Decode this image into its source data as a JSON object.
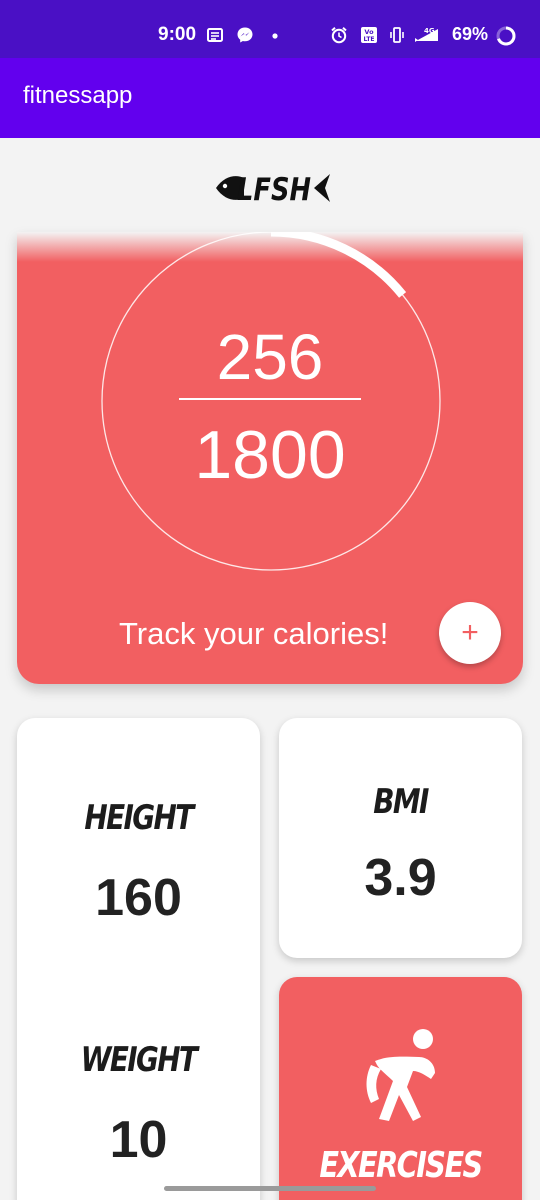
{
  "status_bar": {
    "time": "9:00",
    "battery": "69%",
    "network": "4G",
    "icons": [
      "news-icon",
      "messenger-icon",
      "dot-icon",
      "alarm-icon",
      "volte-icon",
      "vibrate-icon",
      "signal-icon",
      "battery-ring-icon"
    ]
  },
  "app_bar": {
    "title": "fitnessapp"
  },
  "logo": {
    "name": "fish-logo",
    "text": "LFSH"
  },
  "calories": {
    "current": "256",
    "goal": "1800",
    "progress_fraction": 0.142,
    "cta_text": "Track your calories!",
    "add_label": "+"
  },
  "stats": {
    "height_label": "HEIGHT",
    "height_value": "160",
    "weight_label": "WEIGHT",
    "weight_value": "10",
    "bmi_label": "BMI",
    "bmi_value": "3.9"
  },
  "exercises": {
    "label": "EXERCISES",
    "icon": "stretching-person-icon"
  },
  "colors": {
    "status_bar": "#4a10c5",
    "app_bar": "#6200ee",
    "accent": "#f25f61",
    "background": "#f3f3f3"
  }
}
